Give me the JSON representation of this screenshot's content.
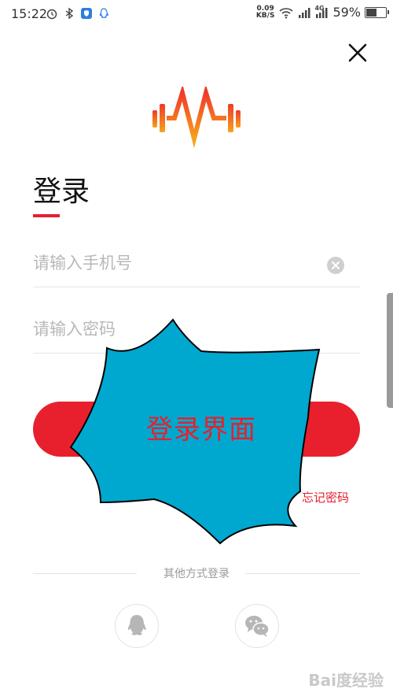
{
  "status_bar": {
    "time": "15:22",
    "net_speed_value": "0.09",
    "net_speed_unit": "KB/S",
    "signal_tag": "4G",
    "battery_percent": "59%",
    "battery_level": 0.59
  },
  "login": {
    "title": "登录",
    "phone_placeholder": "请输入手机号",
    "password_placeholder": "请输入密码",
    "forgot_password": "忘记密码"
  },
  "overlay": {
    "label": "登录界面"
  },
  "alt_login": {
    "divider_text": "其他方式登录",
    "providers": [
      "qq-icon",
      "wechat-icon"
    ]
  },
  "watermark": {
    "text": "Bai度经验"
  },
  "colors": {
    "accent": "#e5202e",
    "burst_fill": "#00a8cf",
    "logo_orange": "#f5871f"
  }
}
